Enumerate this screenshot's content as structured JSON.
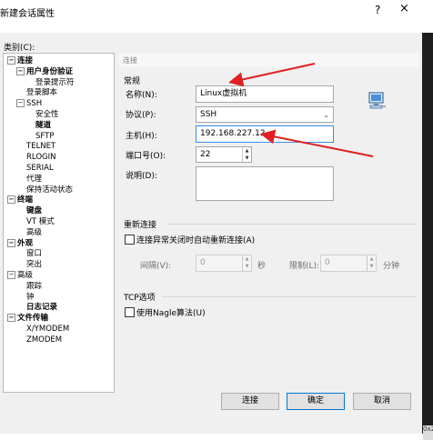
{
  "window": {
    "title": "新建会话属性",
    "help_glyph": "?",
    "close_glyph": "×"
  },
  "right_edge_tag": "0x2",
  "category": {
    "label": "类别(C):",
    "tree": [
      {
        "label": "连接",
        "level": 0,
        "bold": true,
        "expander": "−"
      },
      {
        "label": "用户身份验证",
        "level": 1,
        "bold": true,
        "expander": "−"
      },
      {
        "label": "登录提示符",
        "level": 2,
        "bold": false
      },
      {
        "label": "登录脚本",
        "level": 1,
        "bold": false
      },
      {
        "label": "SSH",
        "level": 1,
        "bold": false,
        "expander": "−"
      },
      {
        "label": "安全性",
        "level": 2,
        "bold": false
      },
      {
        "label": "隧道",
        "level": 2,
        "bold": true
      },
      {
        "label": "SFTP",
        "level": 2,
        "bold": false
      },
      {
        "label": "TELNET",
        "level": 1,
        "bold": false
      },
      {
        "label": "RLOGIN",
        "level": 1,
        "bold": false
      },
      {
        "label": "SERIAL",
        "level": 1,
        "bold": false
      },
      {
        "label": "代理",
        "level": 1,
        "bold": false
      },
      {
        "label": "保持活动状态",
        "level": 1,
        "bold": false
      },
      {
        "label": "终端",
        "level": 0,
        "bold": true,
        "expander": "−"
      },
      {
        "label": "键盘",
        "level": 1,
        "bold": true
      },
      {
        "label": "VT 模式",
        "level": 1,
        "bold": false
      },
      {
        "label": "高级",
        "level": 1,
        "bold": false
      },
      {
        "label": "外观",
        "level": 0,
        "bold": true,
        "expander": "−"
      },
      {
        "label": "窗口",
        "level": 1,
        "bold": false
      },
      {
        "label": "突出",
        "level": 1,
        "bold": false
      },
      {
        "label": "高级",
        "level": 0,
        "bold": false,
        "expander": "−"
      },
      {
        "label": "跟踪",
        "level": 1,
        "bold": false
      },
      {
        "label": "钟",
        "level": 1,
        "bold": false
      },
      {
        "label": "日志记录",
        "level": 1,
        "bold": true
      },
      {
        "label": "文件传输",
        "level": 0,
        "bold": true,
        "expander": "−"
      },
      {
        "label": "X/YMODEM",
        "level": 1,
        "bold": false
      },
      {
        "label": "ZMODEM",
        "level": 1,
        "bold": false
      }
    ]
  },
  "panel": {
    "header": "连接",
    "general_title": "常规",
    "name_label": "名称(N):",
    "name_value": "Linux虚拟机",
    "protocol_label": "协议(P):",
    "protocol_value": "SSH",
    "host_label": "主机(H):",
    "host_value": "192.168.227.12",
    "port_label": "端口号(O):",
    "port_value": "22",
    "desc_label": "说明(D):",
    "desc_value": "",
    "reconnect_title": "重新连接",
    "reconnect_checkbox": "连接异常关闭时自动重新连接(A)",
    "interval_label": "间隔(V):",
    "interval_value": "0",
    "interval_unit": "秒",
    "limit_label": "限制(L):",
    "limit_value": "0",
    "limit_unit": "分钟",
    "tcp_title": "TCP选项",
    "nagle_checkbox": "使用Nagle算法(U)"
  },
  "buttons": {
    "connect": "连接",
    "ok": "确定",
    "cancel": "取消"
  },
  "colors": {
    "annotation_arrow": "#e02020",
    "focus_border": "#3c8ee6",
    "default_button_border": "#0078d7"
  },
  "icons": {
    "session_icon": "computer-network-icon"
  }
}
